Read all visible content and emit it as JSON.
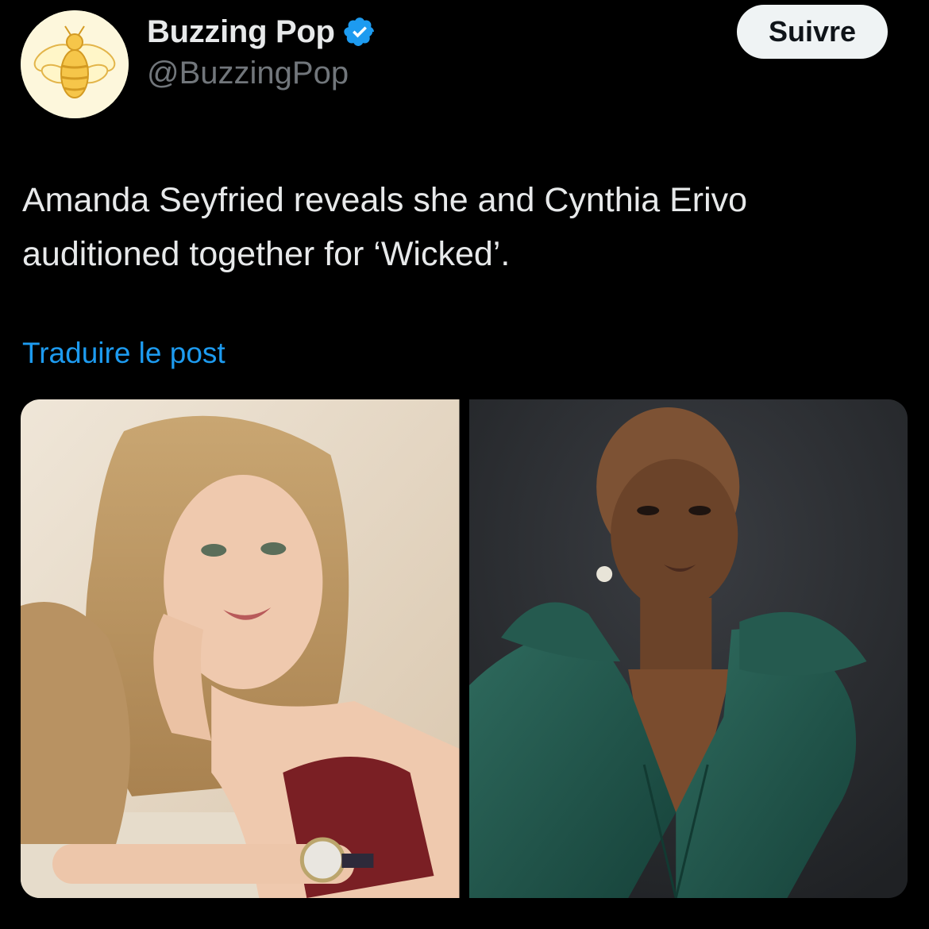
{
  "author": {
    "display_name": "Buzzing Pop",
    "handle": "@BuzzingPop",
    "verified_icon": "verified-badge-icon",
    "avatar_icon": "bee-icon"
  },
  "actions": {
    "follow_label": "Suivre"
  },
  "post": {
    "text": "Amanda Seyfried reveals she and Cynthia Erivo auditioned together for ‘Wicked’.",
    "translate_label": "Traduire le post"
  },
  "media": [
    {
      "type": "photo",
      "subject": "portrait-woman-blonde"
    },
    {
      "type": "photo",
      "subject": "portrait-woman-green-dress"
    }
  ],
  "colors": {
    "background": "#000000",
    "text_primary": "#e7e9ea",
    "text_secondary": "#71767b",
    "link": "#1d9bf0",
    "verified": "#1d9bf0",
    "follow_bg": "#eff3f4"
  }
}
